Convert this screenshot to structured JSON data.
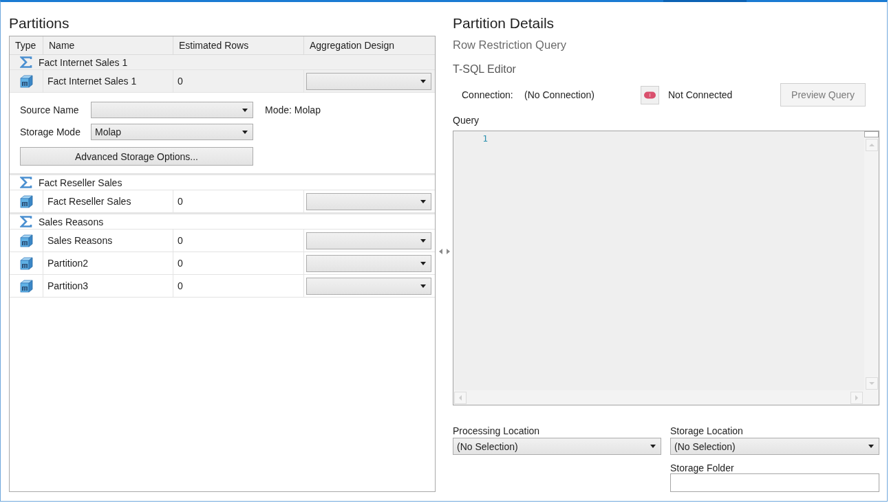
{
  "partitions_panel": {
    "title": "Partitions",
    "columns": [
      "Type",
      "Name",
      "Estimated Rows",
      "Aggregation Design"
    ],
    "groups": [
      {
        "name": "Fact Internet Sales 1",
        "selected": true,
        "partitions": [
          {
            "name": "Fact Internet Sales 1",
            "estimated_rows": "0",
            "selected": true,
            "details": {
              "source_name_label": "Source Name",
              "storage_mode_label": "Storage Mode",
              "storage_mode": "Molap",
              "mode_text": "Mode: Molap",
              "advanced_button": "Advanced Storage Options..."
            }
          }
        ]
      },
      {
        "name": "Fact Reseller Sales",
        "selected": false,
        "partitions": [
          {
            "name": "Fact Reseller Sales",
            "estimated_rows": "0",
            "selected": false
          }
        ]
      },
      {
        "name": "Sales Reasons",
        "selected": false,
        "partitions": [
          {
            "name": "Sales Reasons",
            "estimated_rows": "0",
            "selected": false
          },
          {
            "name": "Partition2",
            "estimated_rows": "0",
            "selected": false
          },
          {
            "name": "Partition3",
            "estimated_rows": "0",
            "selected": false
          }
        ]
      }
    ]
  },
  "partition_details": {
    "title": "Partition Details",
    "subtitle": "Row Restriction Query",
    "editor_title": "T-SQL Editor",
    "connection_label": "Connection:",
    "connection_value": "(No Connection)",
    "connected": false,
    "connection_status": "Not Connected",
    "preview_button": {
      "label": "Preview Query",
      "disabled": true
    },
    "query_label": "Query",
    "line_numbers": [
      "1"
    ],
    "processing_location": {
      "label": "Processing Location",
      "value": "(No Selection)"
    },
    "storage_location": {
      "label": "Storage Location",
      "value": "(No Selection)"
    },
    "storage_folder": {
      "label": "Storage Folder"
    }
  }
}
